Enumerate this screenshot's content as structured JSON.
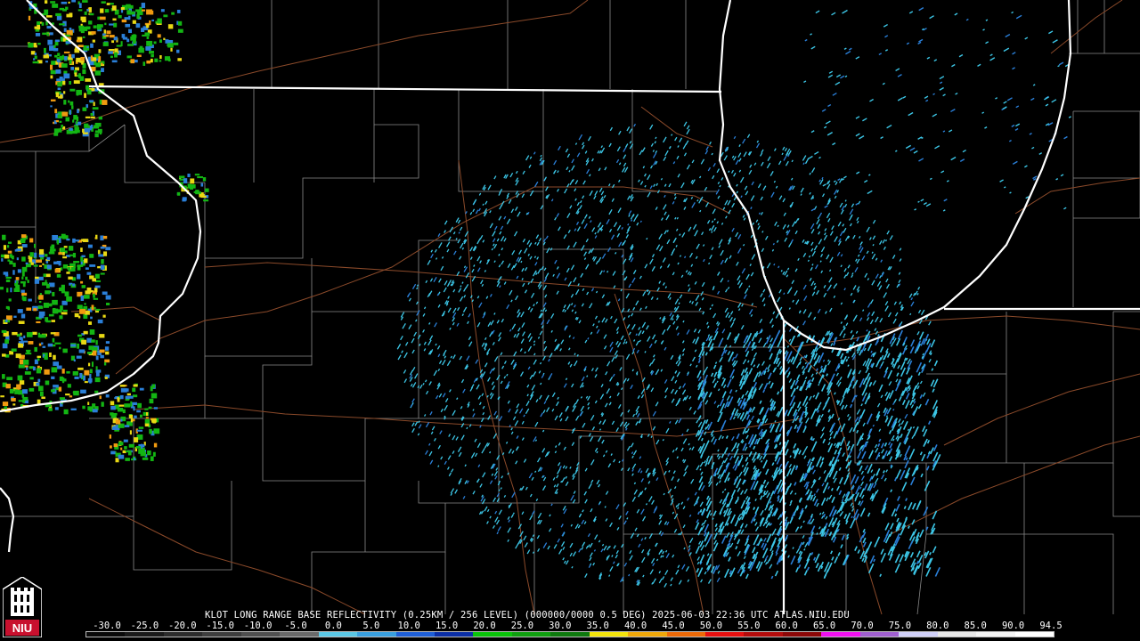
{
  "caption": "KLOT LONG RANGE BASE REFLECTIVITY (0.25KM / 256 LEVEL) (000000/0000 0.5 DEG) 2025-06-03 22:36 UTC  ATLAS.NIU.EDU",
  "scale": {
    "ticks": [
      "-30.0",
      "-25.0",
      "-20.0",
      "-15.0",
      "-10.0",
      "-5.0",
      "0.0",
      "5.0",
      "10.0",
      "15.0",
      "20.0",
      "25.0",
      "30.0",
      "35.0",
      "40.0",
      "45.0",
      "50.0",
      "55.0",
      "60.0",
      "65.0",
      "70.0",
      "75.0",
      "80.0",
      "85.0",
      "90.0",
      "94.5"
    ],
    "colors": [
      "#0a0a0a",
      "#1a1a1a",
      "#2c2c2c",
      "#3e3e3e",
      "#505050",
      "#6a6a6a",
      "#5ac8e6",
      "#39a0e0",
      "#1e5fd8",
      "#0b2fa8",
      "#0ac40a",
      "#10a010",
      "#0e7a0e",
      "#f4e40c",
      "#f0a80a",
      "#ee6a08",
      "#e81010",
      "#b40c0c",
      "#8c0808",
      "#f010f0",
      "#a060d0",
      "#d0d0f8",
      "#e8e8e8",
      "#f4f4f4",
      "#ffffff"
    ]
  },
  "logo": {
    "name": "niu-logo",
    "text": "NIU",
    "color": "#c8102e"
  },
  "colors": {
    "state_border": "#ffffff",
    "county_border": "#8a8a8a",
    "road": "#8b4a2a",
    "echo_light": "#3cc6e6",
    "echo_mid": "#2a7fd8",
    "echo_green": "#13b513",
    "echo_yellow": "#e8d814",
    "echo_orange": "#f09a10"
  }
}
